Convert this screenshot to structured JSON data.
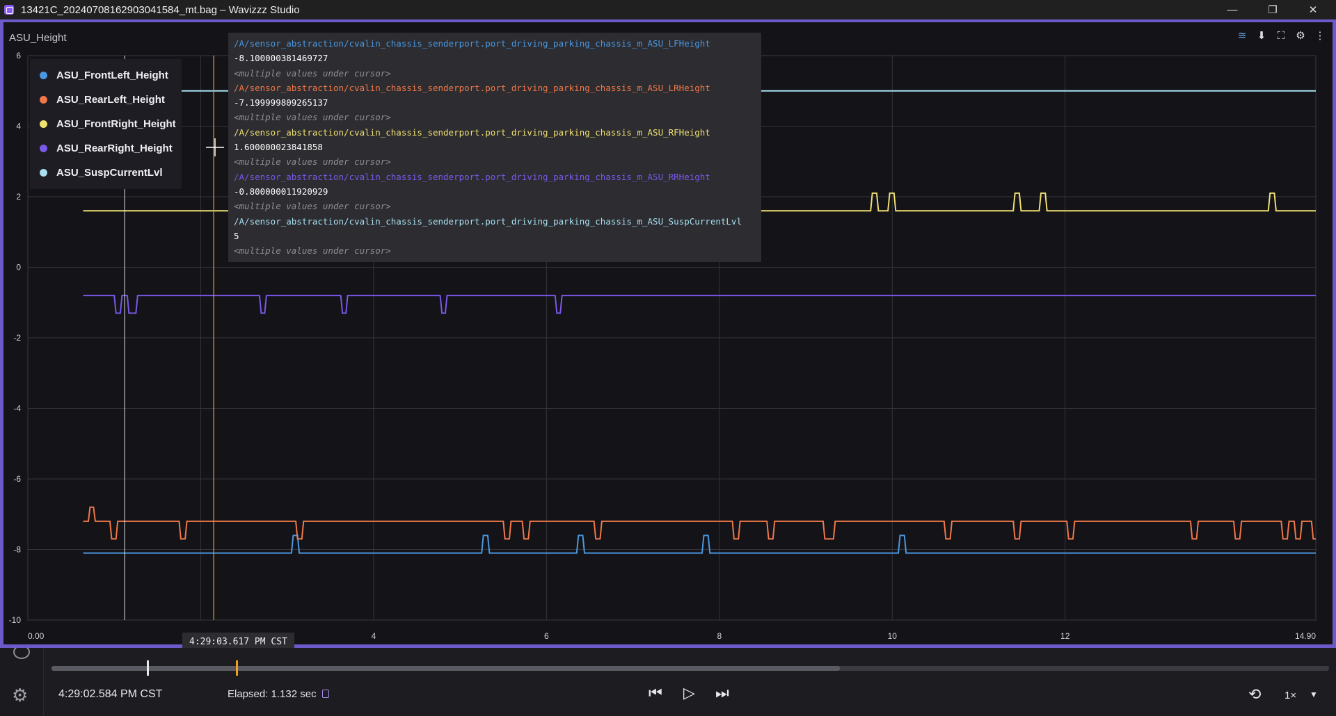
{
  "window": {
    "title": "13421C_20240708162903041584_mt.bag – Wavizzz Studio",
    "minimize": "—",
    "maximize": "❐",
    "close": "✕"
  },
  "panel": {
    "title": "ASU_Height"
  },
  "legend": [
    {
      "label": "ASU_FrontLeft_Height",
      "color": "#4a98e0"
    },
    {
      "label": "ASU_RearLeft_Height",
      "color": "#f07848"
    },
    {
      "label": "ASU_FrontRight_Height",
      "color": "#f0e070"
    },
    {
      "label": "ASU_RearRight_Height",
      "color": "#7a58e8"
    },
    {
      "label": "ASU_SuspCurrentLvl",
      "color": "#a8e0f0"
    }
  ],
  "tooltip": [
    {
      "topic": "/A/sensor_abstraction/cvalin_chassis_senderport.port_driving_parking_chassis_m_ASU_LFHeight",
      "value": "-8.100000381469727",
      "note": "<multiple values under cursor>",
      "color": "#4a98e0"
    },
    {
      "topic": "/A/sensor_abstraction/cvalin_chassis_senderport.port_driving_parking_chassis_m_ASU_LRHeight",
      "value": "-7.199999809265137",
      "note": "<multiple values under cursor>",
      "color": "#f07848"
    },
    {
      "topic": "/A/sensor_abstraction/cvalin_chassis_senderport.port_driving_parking_chassis_m_ASU_RFHeight",
      "value": "1.600000023841858",
      "note": "<multiple values under cursor>",
      "color": "#f0e070"
    },
    {
      "topic": "/A/sensor_abstraction/cvalin_chassis_senderport.port_driving_parking_chassis_m_ASU_RRHeight",
      "value": "-0.800000011920929",
      "note": "<multiple values under cursor>",
      "color": "#7a58e8"
    },
    {
      "topic": "/A/sensor_abstraction/cvalin_chassis_senderport.port_driving_parking_chassis_m_ASU_SuspCurrentLvl",
      "value": "5",
      "note": "<multiple values under cursor>",
      "color": "#a8e0f0"
    }
  ],
  "hover_time": "4:29:03.617 PM CST",
  "playback": {
    "current_time": "4:29:02.584 PM CST",
    "elapsed": "Elapsed: 1.132 sec",
    "speed": "1×",
    "loaded_fraction": 0.617
  },
  "chart_data": {
    "type": "line",
    "title": "ASU_Height",
    "xlim": [
      0,
      14.9
    ],
    "ylim": [
      -10,
      6
    ],
    "xticks": [
      "0.00",
      "2",
      "4",
      "6",
      "8",
      "10",
      "12",
      "14.90"
    ],
    "yticks": [
      "6",
      "4",
      "2",
      "0",
      "-2",
      "-4",
      "-6",
      "-8",
      "-10"
    ],
    "cursor_x": [
      1.12,
      2.15
    ],
    "series": [
      {
        "name": "ASU_FrontLeft_Height",
        "color": "#4a98e0",
        "base": -8.1,
        "points": [
          [
            0.64,
            -8.1
          ],
          [
            3.05,
            -8.1
          ],
          [
            3.07,
            -7.6
          ],
          [
            3.12,
            -7.6
          ],
          [
            3.14,
            -8.1
          ],
          [
            5.25,
            -8.1
          ],
          [
            5.27,
            -7.6
          ],
          [
            5.32,
            -7.6
          ],
          [
            5.34,
            -8.1
          ],
          [
            6.35,
            -8.1
          ],
          [
            6.37,
            -7.6
          ],
          [
            6.42,
            -7.6
          ],
          [
            6.44,
            -8.1
          ],
          [
            7.8,
            -8.1
          ],
          [
            7.82,
            -7.6
          ],
          [
            7.87,
            -7.6
          ],
          [
            7.89,
            -8.1
          ],
          [
            10.07,
            -8.1
          ],
          [
            10.09,
            -7.6
          ],
          [
            10.14,
            -7.6
          ],
          [
            10.16,
            -8.1
          ],
          [
            14.9,
            -8.1
          ]
        ]
      },
      {
        "name": "ASU_RearLeft_Height",
        "color": "#f07848",
        "base": -7.2,
        "points": [
          [
            0.64,
            -7.2
          ],
          [
            0.7,
            -7.2
          ],
          [
            0.72,
            -6.8
          ],
          [
            0.76,
            -6.8
          ],
          [
            0.78,
            -7.2
          ],
          [
            0.95,
            -7.2
          ],
          [
            0.97,
            -7.7
          ],
          [
            1.02,
            -7.7
          ],
          [
            1.04,
            -7.2
          ],
          [
            1.75,
            -7.2
          ],
          [
            1.77,
            -7.7
          ],
          [
            1.82,
            -7.7
          ],
          [
            1.84,
            -7.2
          ],
          [
            3.1,
            -7.2
          ],
          [
            3.12,
            -7.7
          ],
          [
            3.17,
            -7.7
          ],
          [
            3.19,
            -7.2
          ],
          [
            5.5,
            -7.2
          ],
          [
            5.52,
            -7.7
          ],
          [
            5.57,
            -7.7
          ],
          [
            5.59,
            -7.2
          ],
          [
            5.72,
            -7.2
          ],
          [
            5.74,
            -7.7
          ],
          [
            5.79,
            -7.7
          ],
          [
            5.81,
            -7.2
          ],
          [
            6.55,
            -7.2
          ],
          [
            6.57,
            -7.7
          ],
          [
            6.62,
            -7.7
          ],
          [
            6.64,
            -7.2
          ],
          [
            8.15,
            -7.2
          ],
          [
            8.17,
            -7.7
          ],
          [
            8.22,
            -7.7
          ],
          [
            8.24,
            -7.2
          ],
          [
            8.55,
            -7.2
          ],
          [
            8.57,
            -7.7
          ],
          [
            8.62,
            -7.7
          ],
          [
            8.64,
            -7.2
          ],
          [
            9.2,
            -7.2
          ],
          [
            9.22,
            -7.7
          ],
          [
            9.32,
            -7.7
          ],
          [
            9.34,
            -7.2
          ],
          [
            10.6,
            -7.2
          ],
          [
            10.62,
            -7.7
          ],
          [
            10.67,
            -7.7
          ],
          [
            10.69,
            -7.2
          ],
          [
            11.4,
            -7.2
          ],
          [
            11.42,
            -7.7
          ],
          [
            11.47,
            -7.7
          ],
          [
            11.49,
            -7.2
          ],
          [
            12.02,
            -7.2
          ],
          [
            12.04,
            -7.7
          ],
          [
            12.09,
            -7.7
          ],
          [
            12.11,
            -7.2
          ],
          [
            13.45,
            -7.2
          ],
          [
            13.47,
            -7.7
          ],
          [
            13.52,
            -7.7
          ],
          [
            13.54,
            -7.2
          ],
          [
            13.95,
            -7.2
          ],
          [
            13.97,
            -7.7
          ],
          [
            14.02,
            -7.7
          ],
          [
            14.04,
            -7.2
          ],
          [
            14.5,
            -7.2
          ],
          [
            14.52,
            -7.7
          ],
          [
            14.57,
            -7.7
          ],
          [
            14.59,
            -7.2
          ],
          [
            14.65,
            -7.2
          ],
          [
            14.67,
            -7.7
          ],
          [
            14.72,
            -7.7
          ],
          [
            14.74,
            -7.2
          ],
          [
            14.85,
            -7.2
          ],
          [
            14.87,
            -7.7
          ],
          [
            14.9,
            -7.7
          ]
        ]
      },
      {
        "name": "ASU_FrontRight_Height",
        "color": "#f0e070",
        "base": 1.6,
        "points": [
          [
            0.64,
            1.6
          ],
          [
            9.75,
            1.6
          ],
          [
            9.77,
            2.1
          ],
          [
            9.82,
            2.1
          ],
          [
            9.84,
            1.6
          ],
          [
            9.95,
            1.6
          ],
          [
            9.97,
            2.1
          ],
          [
            10.02,
            2.1
          ],
          [
            10.04,
            1.6
          ],
          [
            11.4,
            1.6
          ],
          [
            11.42,
            2.1
          ],
          [
            11.47,
            2.1
          ],
          [
            11.49,
            1.6
          ],
          [
            11.7,
            1.6
          ],
          [
            11.72,
            2.1
          ],
          [
            11.77,
            2.1
          ],
          [
            11.79,
            1.6
          ],
          [
            14.35,
            1.6
          ],
          [
            14.37,
            2.1
          ],
          [
            14.42,
            2.1
          ],
          [
            14.44,
            1.6
          ],
          [
            14.9,
            1.6
          ]
        ]
      },
      {
        "name": "ASU_RearRight_Height",
        "color": "#7a58e8",
        "base": -0.8,
        "points": [
          [
            0.64,
            -0.8
          ],
          [
            1.0,
            -0.8
          ],
          [
            1.02,
            -1.3
          ],
          [
            1.07,
            -1.3
          ],
          [
            1.09,
            -0.8
          ],
          [
            1.15,
            -0.8
          ],
          [
            1.17,
            -1.3
          ],
          [
            1.25,
            -1.3
          ],
          [
            1.27,
            -0.8
          ],
          [
            2.68,
            -0.8
          ],
          [
            2.7,
            -1.3
          ],
          [
            2.74,
            -1.3
          ],
          [
            2.76,
            -0.8
          ],
          [
            3.62,
            -0.8
          ],
          [
            3.64,
            -1.3
          ],
          [
            3.68,
            -1.3
          ],
          [
            3.7,
            -0.8
          ],
          [
            4.77,
            -0.8
          ],
          [
            4.79,
            -1.3
          ],
          [
            4.83,
            -1.3
          ],
          [
            4.85,
            -0.8
          ],
          [
            6.1,
            -0.8
          ],
          [
            6.12,
            -1.3
          ],
          [
            6.16,
            -1.3
          ],
          [
            6.18,
            -0.8
          ],
          [
            14.9,
            -0.8
          ]
        ]
      },
      {
        "name": "ASU_SuspCurrentLvl",
        "color": "#a8e0f0",
        "base": 5,
        "points": [
          [
            0.64,
            5
          ],
          [
            14.9,
            5
          ]
        ]
      }
    ]
  }
}
